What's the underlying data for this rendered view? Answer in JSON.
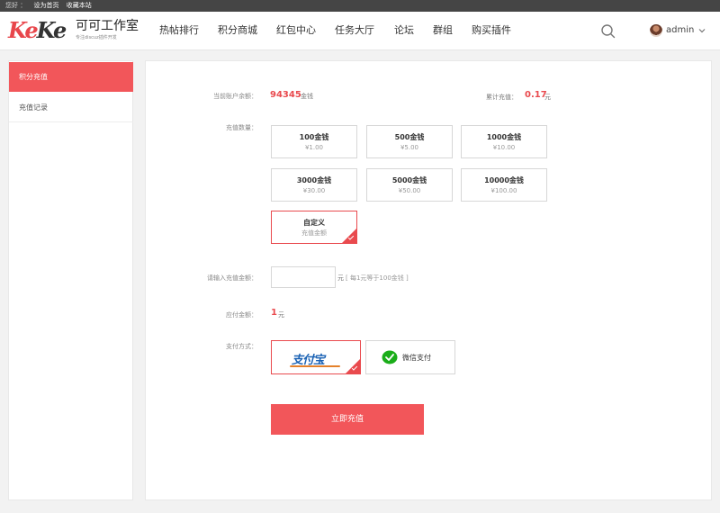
{
  "topbar": {
    "prefix": "您好 ：",
    "links": [
      "设为首页",
      "收藏本站"
    ]
  },
  "brand": {
    "mark_a": "Ke",
    "mark_b": "Ke",
    "name": "可可工作室",
    "tagline": "专注discuz插件开发"
  },
  "nav": {
    "items": [
      "热帖排行",
      "积分商城",
      "红包中心",
      "任务大厅",
      "论坛",
      "群组",
      "购买插件"
    ]
  },
  "user": {
    "name": "admin"
  },
  "sidebar": {
    "items": [
      "积分充值",
      "充值记录"
    ]
  },
  "account": {
    "balance_label": "当前账户余额：",
    "balance_value": "94345",
    "balance_unit": "金钱",
    "total_label": "累计充值：",
    "total_value": "0.17",
    "total_unit": "元"
  },
  "recharge": {
    "label": "充值数量：",
    "options": [
      {
        "title": "100金钱",
        "price": "¥1.00"
      },
      {
        "title": "500金钱",
        "price": "¥5.00"
      },
      {
        "title": "1000金钱",
        "price": "¥10.00"
      },
      {
        "title": "3000金钱",
        "price": "¥30.00"
      },
      {
        "title": "5000金钱",
        "price": "¥50.00"
      },
      {
        "title": "10000金钱",
        "price": "¥100.00"
      }
    ],
    "custom": {
      "title": "自定义",
      "subtitle": "充值金额"
    }
  },
  "amount": {
    "label": "请输入充值金额：",
    "value": "",
    "unit": "元",
    "hint": "[ 每1元等于100金钱 ]"
  },
  "payable": {
    "label": "应付金额：",
    "value": "1",
    "unit": "元"
  },
  "payment": {
    "label": "支付方式：",
    "alipay_text": "支付宝",
    "wechat_label": "微信支付"
  },
  "submit_label": "立即充值",
  "colors": {
    "accent": "#f2565a",
    "highlight": "#e94a4e",
    "alipay_blue": "#1a62b4",
    "wechat_green": "#1aad19"
  }
}
